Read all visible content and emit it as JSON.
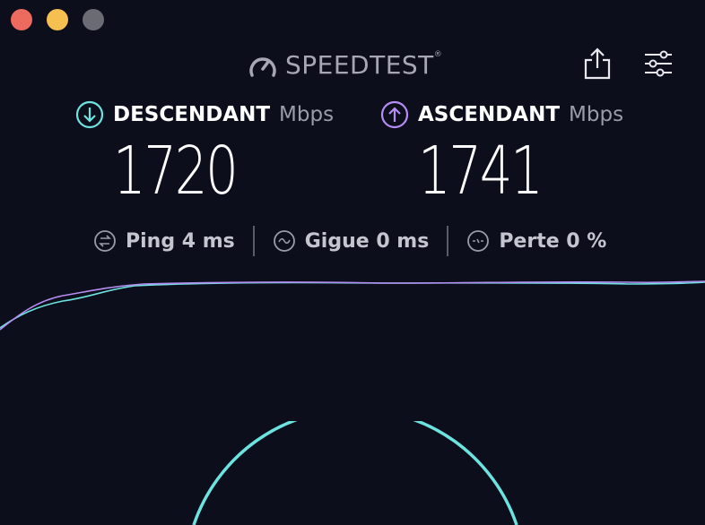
{
  "window": {
    "title": "Speedtest"
  },
  "brand": {
    "name": "SPEEDTEST",
    "trademark": "®"
  },
  "download": {
    "label": "DESCENDANT",
    "unit": "Mbps",
    "value": "1720"
  },
  "upload": {
    "label": "ASCENDANT",
    "unit": "Mbps",
    "value": "1741"
  },
  "stats": {
    "ping": "Ping 4 ms",
    "jitter": "Gigue 0 ms",
    "loss": "Perte 0 %"
  },
  "colors": {
    "background": "#0d0e1c",
    "download_accent": "#6de3e0",
    "upload_accent": "#b58cf2",
    "text_muted": "#9a9ca8"
  },
  "icons": {
    "brand": "gauge-icon",
    "share": "share-icon",
    "settings": "sliders-icon",
    "download": "arrow-down-circle-icon",
    "upload": "arrow-up-circle-icon",
    "ping": "ping-icon",
    "jitter": "jitter-icon",
    "loss": "packet-loss-icon"
  }
}
